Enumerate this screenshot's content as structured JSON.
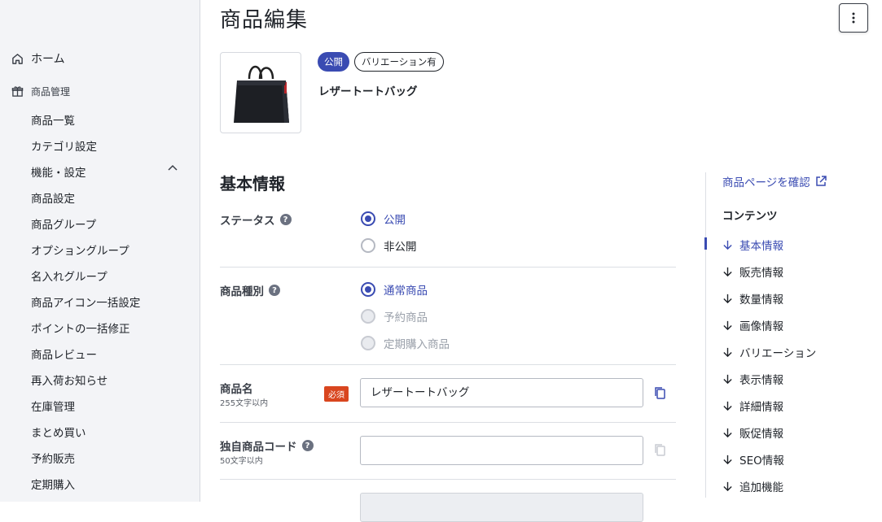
{
  "sidebar": {
    "home": "ホーム",
    "section": "商品管理",
    "items": [
      "商品一覧",
      "カテゴリ設定",
      "機能・設定",
      "商品設定",
      "商品グループ",
      "オプショングループ",
      "名入れグループ",
      "商品アイコン一括設定",
      "ポイントの一括修正",
      "商品レビュー",
      "再入荷お知らせ",
      "在庫管理",
      "まとめ買い",
      "予約販売",
      "定期購入"
    ]
  },
  "header": {
    "title": "商品編集"
  },
  "product": {
    "status_badge": "公開",
    "variation_badge": "バリエーション有",
    "name": "レザートートバッグ"
  },
  "basic": {
    "title": "基本情報",
    "status_label": "ステータス",
    "status_options": [
      "公開",
      "非公開"
    ],
    "type_label": "商品種別",
    "type_options": [
      "通常商品",
      "予約商品",
      "定期購入商品"
    ],
    "name_label": "商品名",
    "name_note": "255文字以内",
    "required": "必須",
    "name_value": "レザートートバッグ",
    "code_label": "独自商品コード",
    "code_note": "50文字以内",
    "code_value": ""
  },
  "toc": {
    "link": "商品ページを確認",
    "heading": "コンテンツ",
    "items": [
      "基本情報",
      "販売情報",
      "数量情報",
      "画像情報",
      "バリエーション",
      "表示情報",
      "詳細情報",
      "販促情報",
      "SEO情報",
      "追加機能"
    ]
  },
  "colors": {
    "accent": "#3a4bb2",
    "required": "#d9461f",
    "sidebar_bg": "#f3f4f7"
  }
}
